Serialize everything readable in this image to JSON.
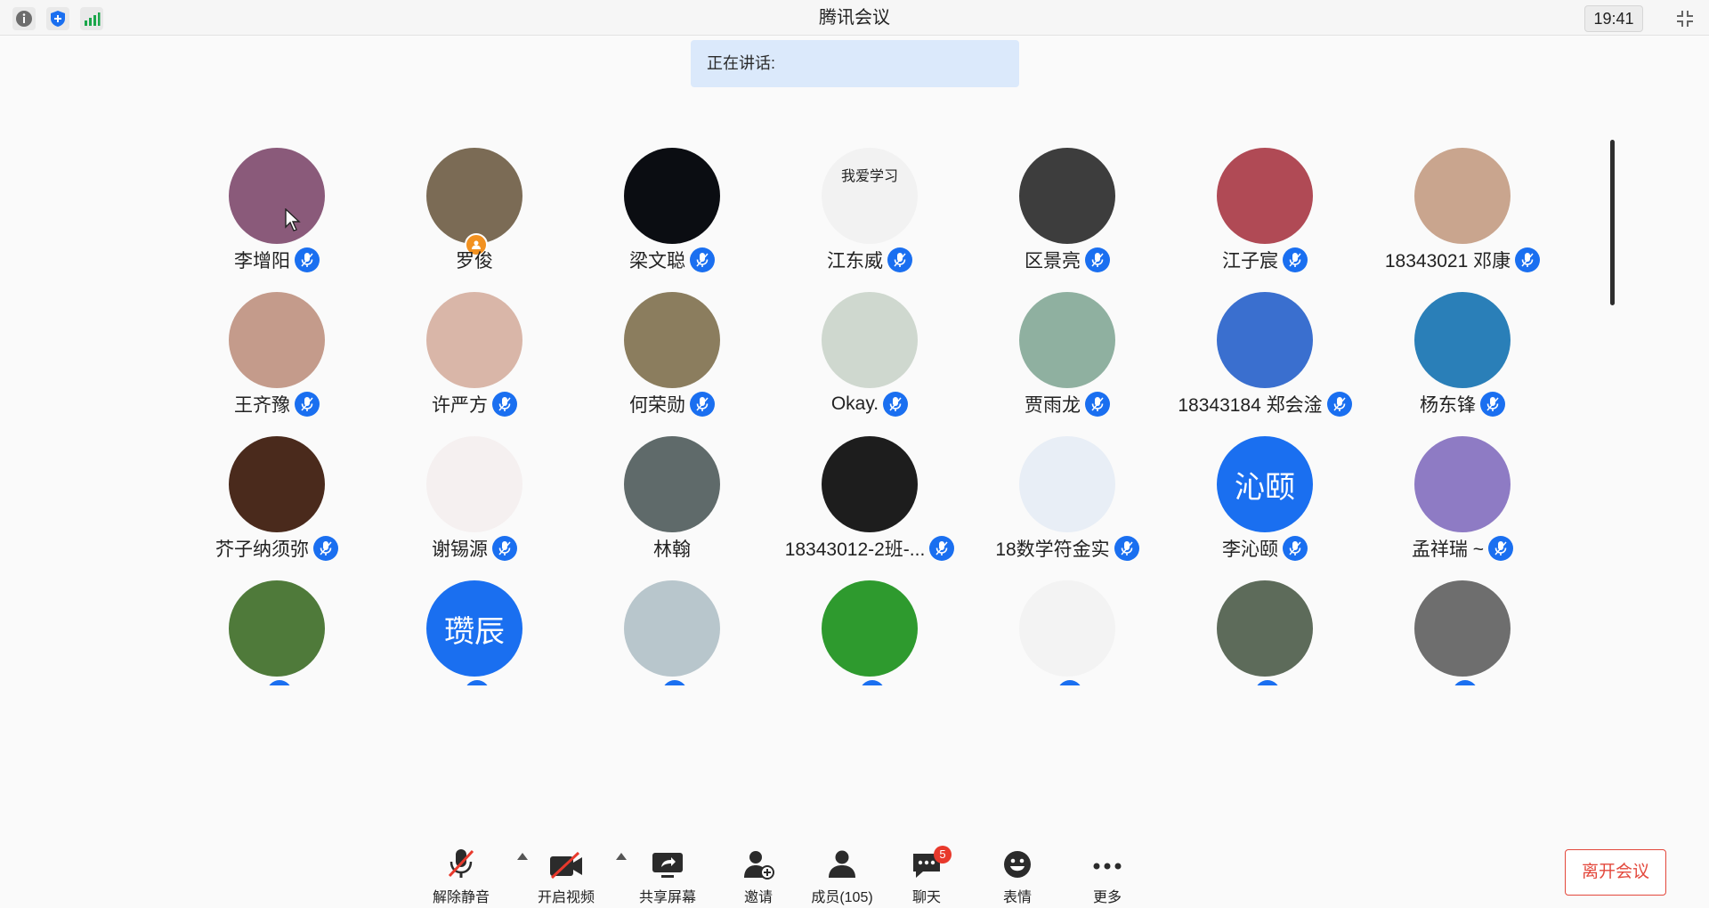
{
  "window": {
    "title": "腾讯会议",
    "time": "19:41"
  },
  "titlebar_icons": [
    {
      "name": "info-icon",
      "color": "#6d6d6d"
    },
    {
      "name": "security-shield-icon",
      "color": "#1a6ff0"
    },
    {
      "name": "signal-bars-icon",
      "color": "#1aa64a"
    }
  ],
  "speaking": {
    "label": "正在讲话:"
  },
  "participants": [
    {
      "name": "李增阳",
      "mic": true,
      "avatar": "#8a5a7a"
    },
    {
      "name": "罗俊",
      "mic": false,
      "host": true,
      "avatar": "#7b6b55"
    },
    {
      "name": "梁文聪",
      "mic": true,
      "avatar": "#0b0d12"
    },
    {
      "name": "江东威",
      "mic": true,
      "avatar": "#f2f2f2",
      "avatar_text": "我爱学习",
      "avatar_text_color": "#222"
    },
    {
      "name": "区景亮",
      "mic": true,
      "avatar": "#3d3d3d"
    },
    {
      "name": "江子宸",
      "mic": true,
      "avatar": "#b04a55"
    },
    {
      "name": "18343021 邓康",
      "mic": true,
      "avatar": "#c9a58e"
    },
    {
      "name": "王齐豫",
      "mic": true,
      "avatar": "#c49b8b"
    },
    {
      "name": "许严方",
      "mic": true,
      "avatar": "#d9b6a8"
    },
    {
      "name": "何荣勋",
      "mic": true,
      "avatar": "#8b7d5e"
    },
    {
      "name": "Okay.",
      "mic": true,
      "avatar": "#cfd8cf"
    },
    {
      "name": "贾雨龙",
      "mic": true,
      "avatar": "#8fb0a0"
    },
    {
      "name": "18343184 郑会淦",
      "mic": true,
      "avatar": "#3a6fcf"
    },
    {
      "name": "杨东锋",
      "mic": true,
      "avatar": "#2a7fb8"
    },
    {
      "name": "芥子纳须弥",
      "mic": true,
      "avatar": "#4a2a1c"
    },
    {
      "name": "谢锡源",
      "mic": true,
      "avatar": "#f5f0f0"
    },
    {
      "name": "林翰",
      "mic": false,
      "avatar": "#5f6a6a"
    },
    {
      "name": "18343012-2班-...",
      "mic": true,
      "avatar": "#1d1d1d"
    },
    {
      "name": "18数学符金实",
      "mic": true,
      "avatar": "#e8eef6"
    },
    {
      "name": "李沁颐",
      "mic": true,
      "avatar": "#1a6ff0",
      "avatar_text": "沁颐",
      "avatar_text_color": "#ffffff"
    },
    {
      "name": "孟祥瑞 ~",
      "mic": true,
      "avatar": "#8e7bc4"
    },
    {
      "name": "",
      "mic": true,
      "avatar": "#4f7a3a"
    },
    {
      "name": "",
      "mic": true,
      "avatar": "#1a6ff0",
      "avatar_text": "瓒辰",
      "avatar_text_color": "#ffffff"
    },
    {
      "name": "",
      "mic": true,
      "avatar": "#b8c6cc"
    },
    {
      "name": "",
      "mic": true,
      "avatar": "#2e9a2e"
    },
    {
      "name": "",
      "mic": true,
      "avatar": "#f3f3f3"
    },
    {
      "name": "",
      "mic": true,
      "avatar": "#5d6b5a"
    },
    {
      "name": "",
      "mic": true,
      "avatar": "#6e6e6e"
    }
  ],
  "toolbar": {
    "unmute": "解除静音",
    "start_video": "开启视频",
    "share_screen": "共享屏幕",
    "invite": "邀请",
    "members": "成员(105)",
    "chat": "聊天",
    "chat_badge": "5",
    "reactions": "表情",
    "more": "更多"
  },
  "leave": {
    "label": "离开会议"
  },
  "colors": {
    "accent": "#1a6ff0",
    "danger": "#e3483c",
    "speaking_bg": "#dbe9fb"
  }
}
